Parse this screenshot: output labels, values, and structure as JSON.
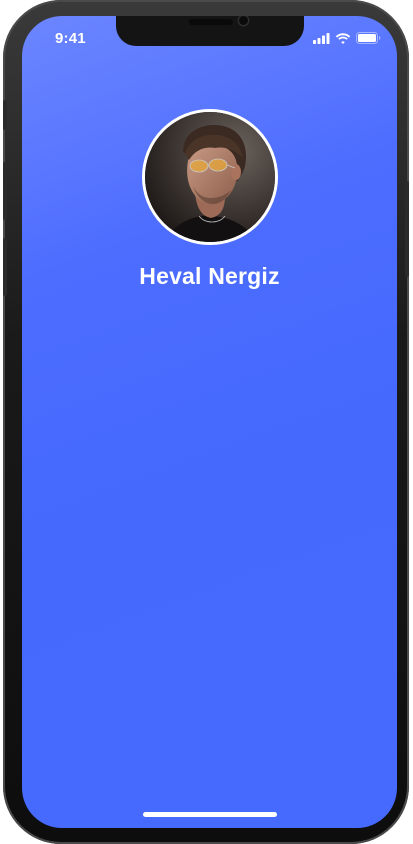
{
  "status_bar": {
    "time": "9:41",
    "icons": [
      "cellular-signal-icon",
      "wifi-icon",
      "battery-icon"
    ]
  },
  "profile": {
    "name": "Heval Nergiz",
    "avatar_alt": "Heval Nergiz"
  },
  "colors": {
    "background_top": "#6c86ff",
    "background_main": "#4669fe",
    "text": "#ffffff",
    "avatar_border": "#ffffff",
    "device_frame": "#1a1a1a"
  }
}
